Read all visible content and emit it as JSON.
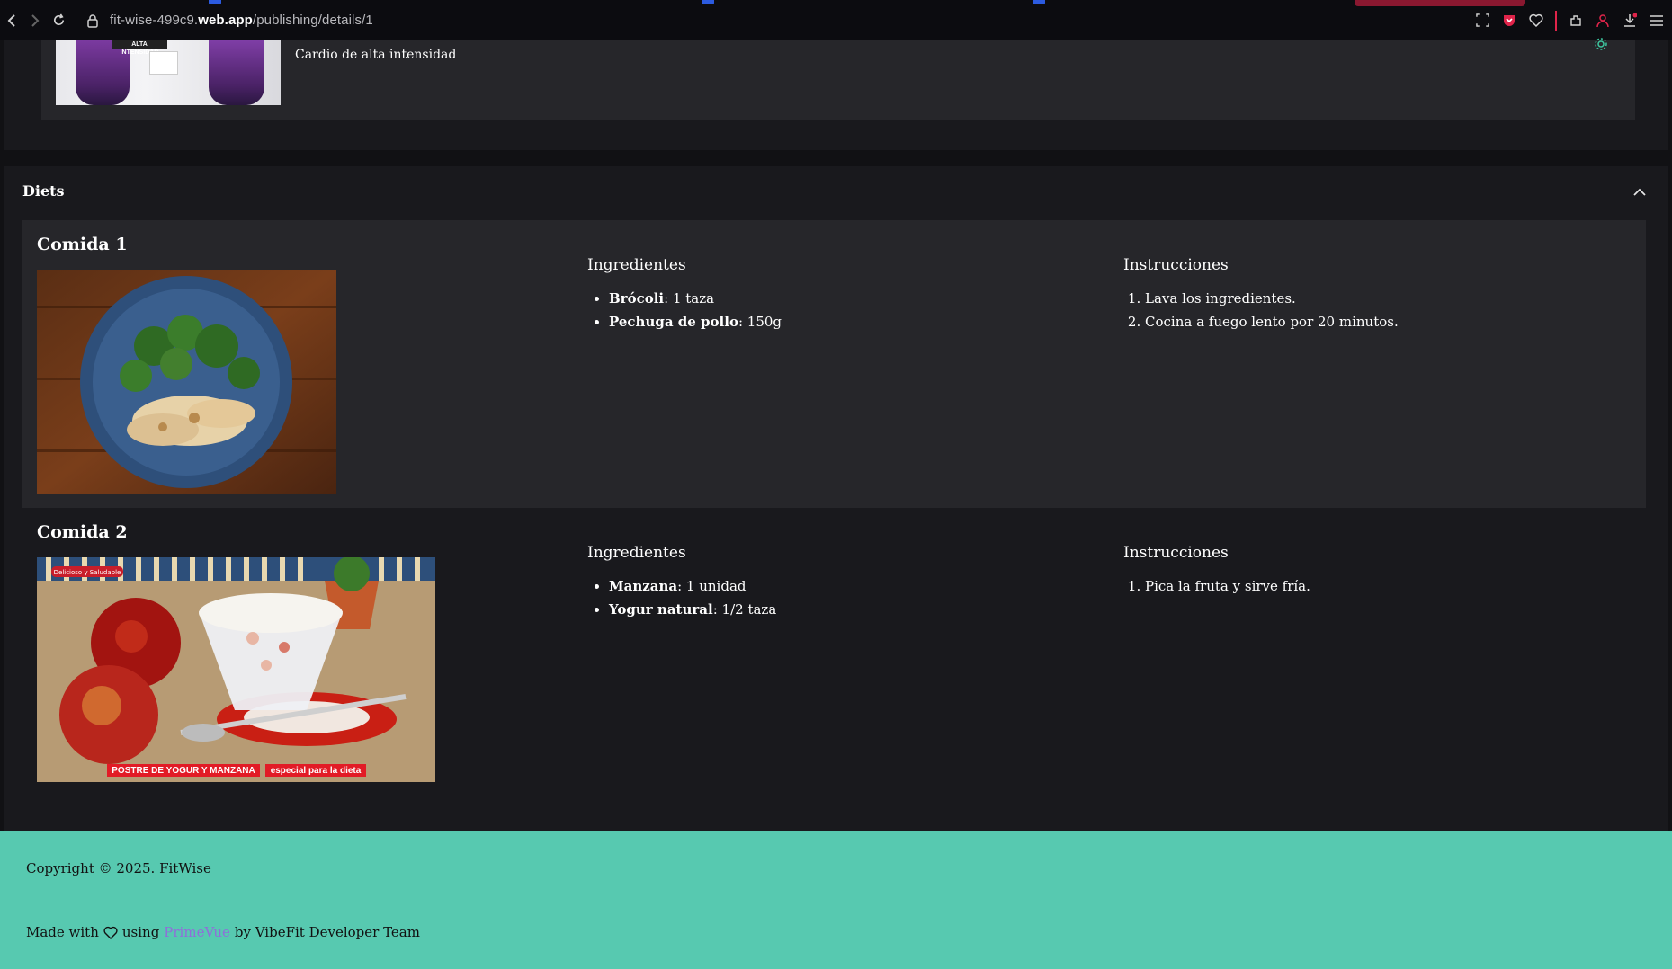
{
  "browser": {
    "url_prefix": "fit-wise-499c9.",
    "url_domain": "web.app",
    "url_path": "/publishing/details/1"
  },
  "workout": {
    "label": "Cardio de alta intensidad",
    "image_badge": "ALTA INTENSIDAD"
  },
  "diets": {
    "title": "Diets",
    "ingredients_heading": "Ingredientes",
    "instructions_heading": "Instrucciones",
    "meals": [
      {
        "title": "Comida 1",
        "ingredients": [
          {
            "name": "Brócoli",
            "qty": ": 1 taza"
          },
          {
            "name": "Pechuga de pollo",
            "qty": ": 150g"
          }
        ],
        "instructions": [
          "Lava los ingredientes.",
          "Cocina a fuego lento por 20 minutos."
        ]
      },
      {
        "title": "Comida 2",
        "image_caption_left": "POSTRE DE YOGUR Y MANZANA",
        "image_caption_right": "especial para la dieta",
        "image_tag": "Delicioso y Saludable",
        "ingredients": [
          {
            "name": "Manzana",
            "qty": ": 1 unidad"
          },
          {
            "name": "Yogur natural",
            "qty": ": 1/2 taza"
          }
        ],
        "instructions": [
          "Pica la fruta y sirve fría."
        ]
      }
    ]
  },
  "footer": {
    "copyright": "Copyright © 2025. FitWise",
    "made_with": "Made with",
    "using": "using",
    "link": "PrimeVue",
    "by": "by VibeFit Developer Team"
  },
  "colors": {
    "footer_bg": "#57c9b0",
    "panel_bg": "#19191d",
    "card_bg": "#26262a",
    "accent_link": "#8f6fd9"
  }
}
